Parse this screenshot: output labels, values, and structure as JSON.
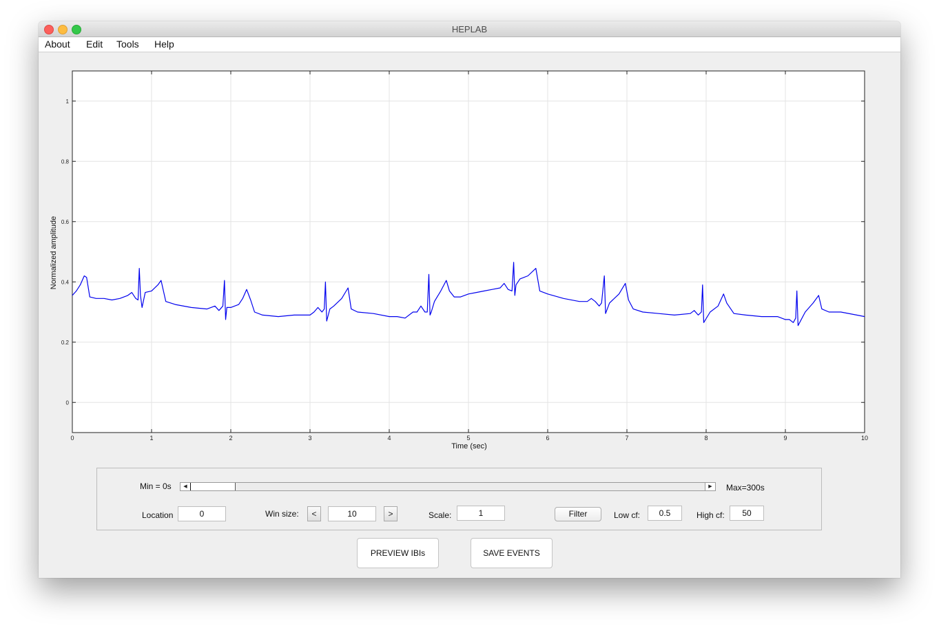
{
  "window": {
    "title": "HEPLAB"
  },
  "menu": [
    "About",
    "Edit",
    "Tools",
    "Help"
  ],
  "chart_data": {
    "type": "line",
    "xlabel": "Time (sec)",
    "ylabel": "Normalized amplitude",
    "xlim": [
      0,
      10
    ],
    "ylim": [
      -0.1,
      1.1
    ],
    "xticks": [
      "0",
      "1",
      "2",
      "3",
      "4",
      "5",
      "6",
      "7",
      "8",
      "9",
      "10"
    ],
    "yticks": [
      "0",
      "0.2",
      "0.4",
      "0.6",
      "0.8",
      "1"
    ],
    "grid": true,
    "line_color": "#0000ee",
    "series": [
      {
        "x": [
          0,
          0.05,
          0.1,
          0.15,
          0.18,
          0.22,
          0.3,
          0.4,
          0.5,
          0.6,
          0.7,
          0.75,
          0.8,
          0.83,
          0.845,
          0.86,
          0.88,
          0.92,
          1.0,
          1.08,
          1.12,
          1.18,
          1.3,
          1.5,
          1.7,
          1.8,
          1.85,
          1.9,
          1.92,
          1.935,
          1.95,
          2.0,
          2.1,
          2.15,
          2.2,
          2.25,
          2.3,
          2.4,
          2.6,
          2.8,
          3.0,
          3.05,
          3.1,
          3.15,
          3.18,
          3.195,
          3.21,
          3.25,
          3.3,
          3.4,
          3.48,
          3.52,
          3.6,
          3.8,
          4.0,
          4.1,
          4.2,
          4.3,
          4.35,
          4.4,
          4.45,
          4.48,
          4.5,
          4.515,
          4.53,
          4.57,
          4.65,
          4.72,
          4.76,
          4.82,
          4.9,
          5.0,
          5.1,
          5.2,
          5.3,
          5.4,
          5.45,
          5.5,
          5.55,
          5.57,
          5.585,
          5.6,
          5.65,
          5.75,
          5.85,
          5.9,
          6.0,
          6.2,
          6.4,
          6.5,
          6.55,
          6.6,
          6.65,
          6.68,
          6.715,
          6.73,
          6.78,
          6.9,
          6.98,
          7.02,
          7.08,
          7.2,
          7.4,
          7.6,
          7.8,
          7.85,
          7.9,
          7.94,
          7.955,
          7.97,
          8.05,
          8.15,
          8.22,
          8.26,
          8.35,
          8.5,
          8.7,
          8.9,
          9.0,
          9.05,
          9.1,
          9.13,
          9.145,
          9.16,
          9.25,
          9.35,
          9.42,
          9.46,
          9.55,
          9.7,
          9.9,
          10.0
        ],
        "values": [
          0.355,
          0.37,
          0.39,
          0.42,
          0.415,
          0.35,
          0.345,
          0.345,
          0.34,
          0.345,
          0.355,
          0.365,
          0.345,
          0.34,
          0.445,
          0.355,
          0.315,
          0.365,
          0.37,
          0.39,
          0.405,
          0.335,
          0.325,
          0.315,
          0.31,
          0.32,
          0.305,
          0.32,
          0.405,
          0.275,
          0.315,
          0.315,
          0.325,
          0.345,
          0.375,
          0.34,
          0.3,
          0.29,
          0.285,
          0.29,
          0.29,
          0.3,
          0.315,
          0.3,
          0.31,
          0.4,
          0.27,
          0.31,
          0.32,
          0.345,
          0.38,
          0.31,
          0.3,
          0.295,
          0.285,
          0.285,
          0.28,
          0.3,
          0.3,
          0.32,
          0.3,
          0.3,
          0.425,
          0.29,
          0.3,
          0.335,
          0.37,
          0.405,
          0.37,
          0.35,
          0.35,
          0.36,
          0.365,
          0.37,
          0.375,
          0.38,
          0.395,
          0.375,
          0.37,
          0.465,
          0.355,
          0.39,
          0.41,
          0.42,
          0.445,
          0.37,
          0.36,
          0.345,
          0.335,
          0.335,
          0.345,
          0.335,
          0.32,
          0.33,
          0.42,
          0.295,
          0.33,
          0.36,
          0.395,
          0.34,
          0.31,
          0.3,
          0.295,
          0.29,
          0.295,
          0.305,
          0.29,
          0.3,
          0.39,
          0.265,
          0.3,
          0.32,
          0.36,
          0.33,
          0.295,
          0.29,
          0.285,
          0.285,
          0.275,
          0.275,
          0.265,
          0.28,
          0.37,
          0.255,
          0.3,
          0.33,
          0.355,
          0.31,
          0.3,
          0.3,
          0.29,
          0.285
        ]
      }
    ]
  },
  "controls": {
    "min_label": "Min = 0s",
    "max_label": "Max=300s",
    "slider_fraction": 0.0,
    "location_label": "Location",
    "location_value": "0",
    "winsize_label": "Win size:",
    "winsize_dec": "<",
    "winsize_value": "10",
    "winsize_inc": ">",
    "scale_label": "Scale:",
    "scale_value": "1",
    "filter_label": "Filter",
    "lowcf_label": "Low cf:",
    "lowcf_value": "0.5",
    "highcf_label": "High cf:",
    "highcf_value": "50"
  },
  "buttons": {
    "preview": "PREVIEW IBIs",
    "save": "SAVE EVENTS"
  }
}
